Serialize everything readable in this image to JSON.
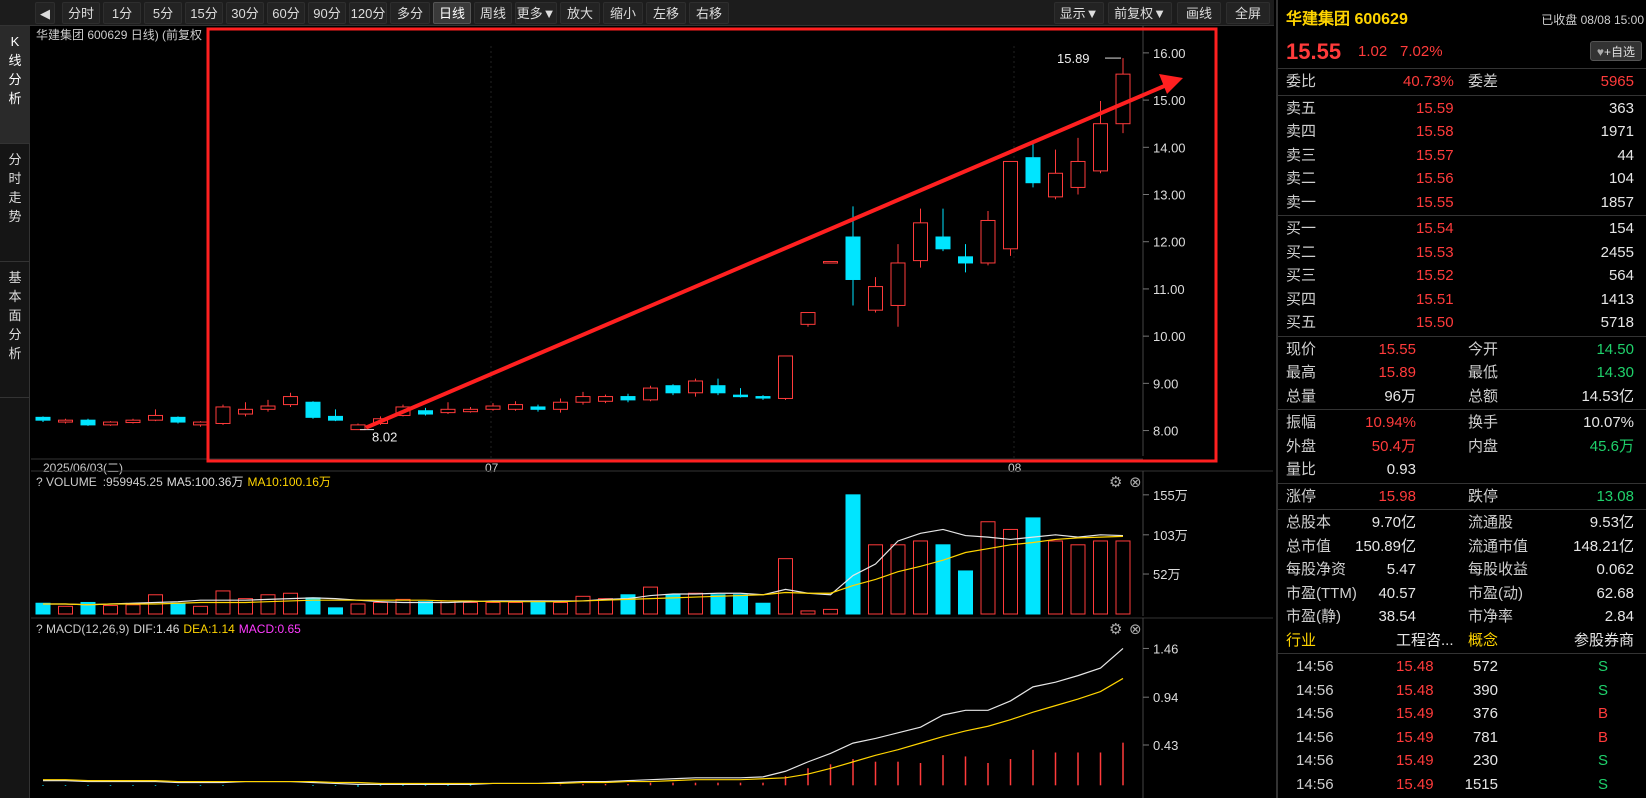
{
  "toolbar": {
    "nav_icon": "left-arrow-icon",
    "buttons": [
      "分时",
      "1分",
      "5分",
      "15分",
      "30分",
      "60分",
      "90分",
      "120分",
      "多分钟",
      "日线",
      "周线",
      "更多▼",
      "放大",
      "缩小",
      "左移",
      "右移"
    ],
    "active": "日线",
    "right_buttons": [
      "显示▼",
      "前复权▼",
      "画线",
      "全屏"
    ]
  },
  "left_tabs": [
    {
      "label": [
        "K",
        "线",
        "分",
        "析"
      ],
      "active": true
    },
    {
      "label": [
        "分",
        "时",
        "走",
        "势"
      ],
      "active": false
    },
    {
      "label": [
        "基",
        "本",
        "面",
        "分",
        "析"
      ],
      "active": false
    }
  ],
  "main_chart": {
    "header": "华建集团 600629 日线) (前复权",
    "date_label": "2025/06/03(二)",
    "month_labels": [
      "07",
      "08"
    ],
    "y_ticks": [
      "16.00",
      "15.00",
      "14.00",
      "13.00",
      "12.00",
      "11.00",
      "10.00",
      "9.00",
      "8.00"
    ],
    "high_label": "15.89",
    "low_label": "8.02",
    "annotation_color": "#ff2020"
  },
  "volume": {
    "title": "VOLUME",
    "value": ":959945.25",
    "ma5": "MA5:100.36万",
    "ma10": "MA10:100.16万",
    "y_ticks": [
      "155万",
      "103万",
      "52万"
    ]
  },
  "macd": {
    "title": "MACD(12,26,9)",
    "dif": "DIF:1.46",
    "dea": "DEA:1.14",
    "macd": "MACD:0.65",
    "y_ticks": [
      "1.46",
      "0.94",
      "0.43"
    ]
  },
  "chart_data": {
    "type": "candlestick",
    "candles": [
      {
        "o": 8.28,
        "c": 8.22,
        "h": 8.3,
        "l": 8.18
      },
      {
        "o": 8.18,
        "c": 8.22,
        "h": 8.25,
        "l": 8.15
      },
      {
        "o": 8.22,
        "c": 8.12,
        "h": 8.25,
        "l": 8.1
      },
      {
        "o": 8.12,
        "c": 8.18,
        "h": 8.2,
        "l": 8.1
      },
      {
        "o": 8.17,
        "c": 8.22,
        "h": 8.25,
        "l": 8.15
      },
      {
        "o": 8.22,
        "c": 8.32,
        "h": 8.45,
        "l": 8.2
      },
      {
        "o": 8.28,
        "c": 8.18,
        "h": 8.3,
        "l": 8.15
      },
      {
        "o": 8.12,
        "c": 8.18,
        "h": 8.2,
        "l": 8.08
      },
      {
        "o": 8.15,
        "c": 8.5,
        "h": 8.55,
        "l": 8.12
      },
      {
        "o": 8.35,
        "c": 8.45,
        "h": 8.6,
        "l": 8.3
      },
      {
        "o": 8.45,
        "c": 8.52,
        "h": 8.65,
        "l": 8.4
      },
      {
        "o": 8.55,
        "c": 8.72,
        "h": 8.8,
        "l": 8.5
      },
      {
        "o": 8.6,
        "c": 8.28,
        "h": 8.62,
        "l": 8.25
      },
      {
        "o": 8.3,
        "c": 8.22,
        "h": 8.45,
        "l": 8.2
      },
      {
        "o": 8.02,
        "c": 8.12,
        "h": 8.15,
        "l": 8.02
      },
      {
        "o": 8.15,
        "c": 8.25,
        "h": 8.3,
        "l": 8.12
      },
      {
        "o": 8.32,
        "c": 8.5,
        "h": 8.55,
        "l": 8.3
      },
      {
        "o": 8.42,
        "c": 8.35,
        "h": 8.48,
        "l": 8.32
      },
      {
        "o": 8.38,
        "c": 8.45,
        "h": 8.6,
        "l": 8.35
      },
      {
        "o": 8.4,
        "c": 8.45,
        "h": 8.5,
        "l": 8.38
      },
      {
        "o": 8.45,
        "c": 8.52,
        "h": 8.58,
        "l": 8.42
      },
      {
        "o": 8.45,
        "c": 8.55,
        "h": 8.62,
        "l": 8.42
      },
      {
        "o": 8.5,
        "c": 8.45,
        "h": 8.55,
        "l": 8.4
      },
      {
        "o": 8.45,
        "c": 8.6,
        "h": 8.68,
        "l": 8.38
      },
      {
        "o": 8.6,
        "c": 8.72,
        "h": 8.82,
        "l": 8.55
      },
      {
        "o": 8.62,
        "c": 8.72,
        "h": 8.76,
        "l": 8.58
      },
      {
        "o": 8.72,
        "c": 8.65,
        "h": 8.78,
        "l": 8.6
      },
      {
        "o": 8.65,
        "c": 8.9,
        "h": 8.95,
        "l": 8.62
      },
      {
        "o": 8.95,
        "c": 8.8,
        "h": 8.98,
        "l": 8.75
      },
      {
        "o": 8.8,
        "c": 9.05,
        "h": 9.1,
        "l": 8.72
      },
      {
        "o": 8.95,
        "c": 8.8,
        "h": 9.1,
        "l": 8.75
      },
      {
        "o": 8.75,
        "c": 8.72,
        "h": 8.9,
        "l": 8.7
      },
      {
        "o": 8.72,
        "c": 8.7,
        "h": 8.75,
        "l": 8.65
      },
      {
        "o": 8.68,
        "c": 9.58,
        "h": 9.58,
        "l": 8.65
      },
      {
        "o": 10.25,
        "c": 10.5,
        "h": 10.5,
        "l": 10.2
      },
      {
        "o": 11.58,
        "c": 11.58,
        "h": 11.58,
        "l": 11.58
      },
      {
        "o": 12.1,
        "c": 11.2,
        "h": 12.75,
        "l": 10.65
      },
      {
        "o": 10.55,
        "c": 11.05,
        "h": 11.25,
        "l": 10.5
      },
      {
        "o": 10.65,
        "c": 11.55,
        "h": 11.95,
        "l": 10.2
      },
      {
        "o": 11.6,
        "c": 12.4,
        "h": 12.7,
        "l": 11.45
      },
      {
        "o": 12.1,
        "c": 11.85,
        "h": 12.7,
        "l": 11.8
      },
      {
        "o": 11.68,
        "c": 11.55,
        "h": 11.95,
        "l": 11.35
      },
      {
        "o": 11.55,
        "c": 12.45,
        "h": 12.65,
        "l": 11.5
      },
      {
        "o": 11.85,
        "c": 13.7,
        "h": 13.7,
        "l": 11.7
      },
      {
        "o": 13.78,
        "c": 13.25,
        "h": 14.15,
        "l": 13.15
      },
      {
        "o": 12.95,
        "c": 13.45,
        "h": 13.95,
        "l": 12.9
      },
      {
        "o": 13.15,
        "c": 13.7,
        "h": 14.2,
        "l": 13.0
      },
      {
        "o": 13.5,
        "c": 14.5,
        "h": 14.98,
        "l": 13.45
      },
      {
        "o": 14.5,
        "c": 15.55,
        "h": 15.89,
        "l": 14.3
      }
    ],
    "volume_wan": [
      14,
      10,
      15,
      11,
      12,
      25,
      14,
      10,
      30,
      20,
      25,
      27,
      21,
      8,
      13,
      15,
      19,
      16,
      17,
      15,
      15,
      15,
      17,
      15,
      23,
      20,
      25,
      35,
      25,
      27,
      25,
      25,
      14,
      72,
      4,
      6,
      155,
      90,
      90,
      95,
      90,
      56,
      120,
      110,
      125,
      95,
      90,
      95,
      95
    ],
    "volume_ma5_wan": [
      13,
      13,
      12,
      13,
      14,
      15,
      16,
      18,
      18,
      18,
      19,
      20,
      21,
      20,
      18,
      16,
      15,
      15,
      15,
      16,
      17,
      17,
      17,
      17,
      17,
      19,
      20,
      24,
      26,
      26,
      27,
      27,
      25,
      32,
      27,
      25,
      50,
      65,
      95,
      105,
      110,
      102,
      100,
      97,
      100,
      103,
      100,
      103,
      102
    ],
    "volume_ma10_wan": [
      13,
      13,
      12,
      13,
      13,
      13,
      14,
      15,
      15,
      15,
      16,
      17,
      18,
      18,
      18,
      18,
      18,
      18,
      17,
      17,
      16,
      16,
      16,
      16,
      17,
      18,
      19,
      20,
      21,
      22,
      23,
      24,
      25,
      28,
      27,
      27,
      37,
      45,
      55,
      62,
      70,
      80,
      85,
      90,
      93,
      97,
      99,
      100,
      101
    ],
    "macd_dif": [
      0.05,
      0.05,
      0.04,
      0.04,
      0.04,
      0.04,
      0.03,
      0.03,
      0.03,
      0.04,
      0.04,
      0.04,
      0.03,
      0.02,
      0.01,
      0.01,
      0.01,
      0.01,
      0.01,
      0.01,
      0.02,
      0.02,
      0.02,
      0.03,
      0.04,
      0.04,
      0.05,
      0.06,
      0.07,
      0.08,
      0.08,
      0.08,
      0.09,
      0.15,
      0.25,
      0.34,
      0.45,
      0.5,
      0.56,
      0.62,
      0.75,
      0.8,
      0.8,
      0.9,
      1.05,
      1.1,
      1.17,
      1.25,
      1.46
    ],
    "macd_dea": [
      0.06,
      0.06,
      0.05,
      0.05,
      0.05,
      0.05,
      0.04,
      0.04,
      0.04,
      0.04,
      0.04,
      0.04,
      0.04,
      0.03,
      0.03,
      0.02,
      0.02,
      0.02,
      0.02,
      0.02,
      0.02,
      0.02,
      0.02,
      0.02,
      0.03,
      0.03,
      0.04,
      0.04,
      0.05,
      0.06,
      0.06,
      0.06,
      0.07,
      0.08,
      0.12,
      0.18,
      0.25,
      0.32,
      0.38,
      0.45,
      0.52,
      0.58,
      0.63,
      0.7,
      0.78,
      0.85,
      0.92,
      1.0,
      1.14
    ],
    "macd_hist": [
      -0.01,
      -0.01,
      -0.01,
      -0.01,
      -0.01,
      -0.01,
      -0.01,
      -0.01,
      -0.01,
      0.0,
      0.0,
      0.0,
      -0.01,
      -0.01,
      -0.02,
      -0.01,
      -0.01,
      -0.01,
      -0.01,
      -0.01,
      0.0,
      0.0,
      0.0,
      0.01,
      0.02,
      0.02,
      0.02,
      0.04,
      0.04,
      0.04,
      0.04,
      0.04,
      0.04,
      0.14,
      0.26,
      0.32,
      0.4,
      0.36,
      0.36,
      0.34,
      0.46,
      0.44,
      0.34,
      0.4,
      0.54,
      0.5,
      0.5,
      0.5,
      0.65
    ],
    "ylim_price": [
      7.8,
      16.4
    ]
  },
  "panel": {
    "title": "华建集团 600629",
    "status": "已收盘 08/08 15:00",
    "price": "15.55",
    "change": "1.02",
    "change_pct": "7.02%",
    "watch_label": "+自选",
    "weibi_label": "委比",
    "weibi": "40.73%",
    "weicha_label": "委差",
    "weicha": "5965",
    "sell": [
      {
        "label": "卖五",
        "price": "15.59",
        "vol": "363"
      },
      {
        "label": "卖四",
        "price": "15.58",
        "vol": "1971"
      },
      {
        "label": "卖三",
        "price": "15.57",
        "vol": "44"
      },
      {
        "label": "卖二",
        "price": "15.56",
        "vol": "104"
      },
      {
        "label": "卖一",
        "price": "15.55",
        "vol": "1857"
      }
    ],
    "buy": [
      {
        "label": "买一",
        "price": "15.54",
        "vol": "154"
      },
      {
        "label": "买二",
        "price": "15.53",
        "vol": "2455"
      },
      {
        "label": "买三",
        "price": "15.52",
        "vol": "564"
      },
      {
        "label": "买四",
        "price": "15.51",
        "vol": "1413"
      },
      {
        "label": "买五",
        "price": "15.50",
        "vol": "5718"
      }
    ],
    "stats1": [
      {
        "l1": "现价",
        "v1": "15.55",
        "c1": "red",
        "l2": "今开",
        "v2": "14.50",
        "c2": "green"
      },
      {
        "l1": "最高",
        "v1": "15.89",
        "c1": "red",
        "l2": "最低",
        "v2": "14.30",
        "c2": "green"
      },
      {
        "l1": "总量",
        "v1": "96万",
        "c1": "white",
        "l2": "总额",
        "v2": "14.53亿",
        "c2": "white"
      }
    ],
    "stats2": [
      {
        "l1": "振幅",
        "v1": "10.94%",
        "c1": "red",
        "l2": "换手",
        "v2": "10.07%",
        "c2": "white"
      },
      {
        "l1": "外盘",
        "v1": "50.4万",
        "c1": "red",
        "l2": "内盘",
        "v2": "45.6万",
        "c2": "green"
      },
      {
        "l1": "量比",
        "v1": "0.93",
        "c1": "white",
        "l2": "",
        "v2": "",
        "c2": "white"
      }
    ],
    "limits": {
      "l1": "涨停",
      "v1": "15.98",
      "l2": "跌停",
      "v2": "13.08"
    },
    "stats3": [
      {
        "l1": "总股本",
        "v1": "9.70亿",
        "l2": "流通股",
        "v2": "9.53亿"
      },
      {
        "l1": "总市值",
        "v1": "150.89亿",
        "l2": "流通市值",
        "v2": "148.21亿"
      },
      {
        "l1": "每股净资",
        "v1": "5.47",
        "l2": "每股收益",
        "v2": "0.062"
      },
      {
        "l1": "市盈(TTM)",
        "v1": "40.57",
        "l2": "市盈(动)",
        "v2": "62.68"
      },
      {
        "l1": "市盈(静)",
        "v1": "38.54",
        "l2": "市净率",
        "v2": "2.84"
      }
    ],
    "industry_row": {
      "l1": "行业",
      "v1": "工程咨...",
      "l2": "概念",
      "v2": "参股券商"
    },
    "ticks": [
      {
        "time": "14:56",
        "price": "15.48",
        "vol": "572",
        "side": "S"
      },
      {
        "time": "14:56",
        "price": "15.48",
        "vol": "390",
        "side": "S"
      },
      {
        "time": "14:56",
        "price": "15.49",
        "vol": "376",
        "side": "B"
      },
      {
        "time": "14:56",
        "price": "15.49",
        "vol": "781",
        "side": "B"
      },
      {
        "time": "14:56",
        "price": "15.49",
        "vol": "230",
        "side": "S"
      },
      {
        "time": "14:56",
        "price": "15.49",
        "vol": "1515",
        "side": "S"
      }
    ]
  }
}
